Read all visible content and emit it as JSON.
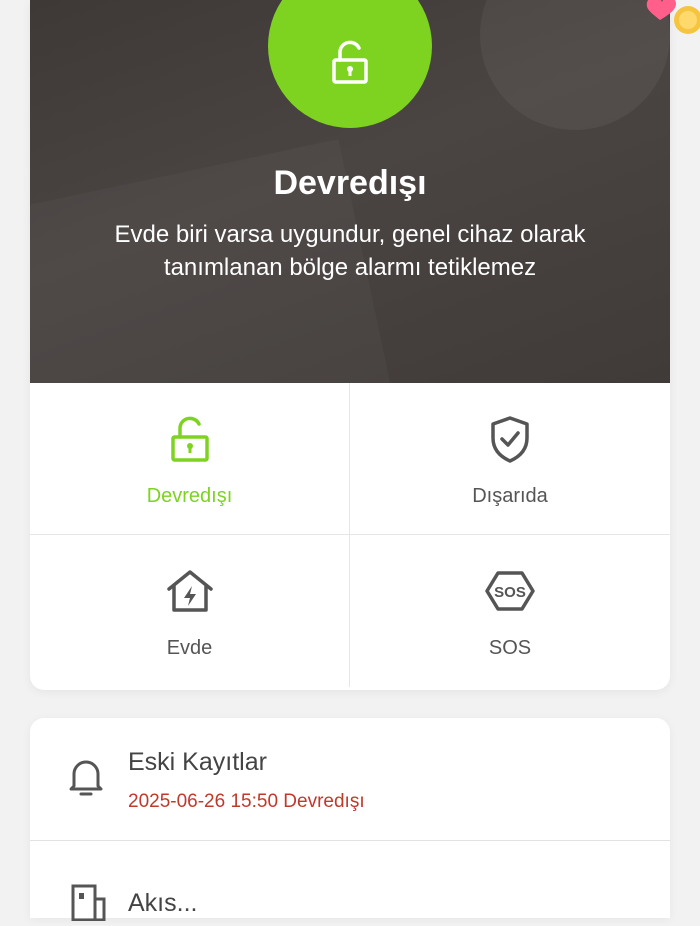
{
  "status": {
    "title": "Devredışı",
    "description": "Evde biri varsa uygundur, genel cihaz olarak tanımlanan bölge alarmı tetiklemez",
    "color": "#7ed321",
    "icon": "unlocked-padlock-icon"
  },
  "modes": [
    {
      "label": "Devredışı",
      "icon": "unlocked-padlock-icon",
      "active": true
    },
    {
      "label": "Dışarıda",
      "icon": "shield-check-icon",
      "active": false
    },
    {
      "label": "Evde",
      "icon": "home-bolt-icon",
      "active": false
    },
    {
      "label": "SOS",
      "icon": "sos-icon",
      "active": false
    }
  ],
  "records": {
    "title": "Eski Kayıtlar",
    "latest": "2025-06-26 15:50 Devredışı",
    "latest_color": "#c0392b",
    "icon": "bell-icon"
  },
  "next_item": {
    "label": "Akıs...",
    "icon": "building-icon"
  }
}
